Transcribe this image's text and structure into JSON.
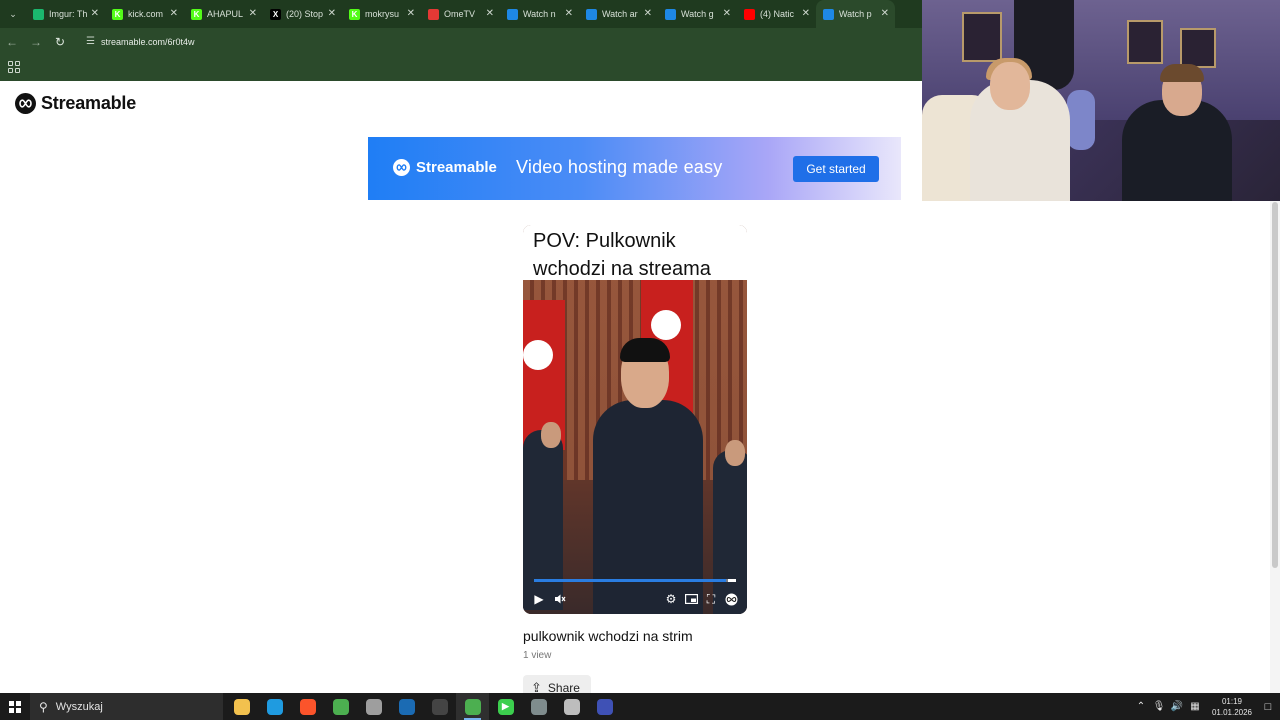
{
  "browser": {
    "tabs": [
      {
        "title": "Imgur: Th",
        "favicon_color": "#1bb76e",
        "glyph": "",
        "active": false
      },
      {
        "title": "kick.com",
        "favicon_color": "#53fc18",
        "glyph": "K",
        "active": false
      },
      {
        "title": "AHAPUL",
        "favicon_color": "#53fc18",
        "glyph": "K",
        "active": false
      },
      {
        "title": "(20) Stop",
        "favicon_color": "#000000",
        "glyph": "X",
        "active": false
      },
      {
        "title": "mokrysu",
        "favicon_color": "#53fc18",
        "glyph": "K",
        "active": false
      },
      {
        "title": "OmeTV",
        "favicon_color": "#e53935",
        "glyph": "",
        "active": false
      },
      {
        "title": "Watch n",
        "favicon_color": "#1e88e5",
        "glyph": "",
        "active": false
      },
      {
        "title": "Watch ar",
        "favicon_color": "#1e88e5",
        "glyph": "",
        "active": false
      },
      {
        "title": "Watch g",
        "favicon_color": "#1e88e5",
        "glyph": "",
        "active": false
      },
      {
        "title": "(4) Natic",
        "favicon_color": "#ff0000",
        "glyph": "",
        "active": false
      },
      {
        "title": "Watch p",
        "favicon_color": "#1e88e5",
        "glyph": "",
        "active": true
      }
    ],
    "url": "streamable.com/6r0t4w"
  },
  "page": {
    "brand": "Streamable",
    "banner": {
      "brand": "Streamable",
      "tagline": "Video hosting made easy",
      "cta": "Get started"
    },
    "video": {
      "caption": "POV: Pulkownik wchodzi na streama",
      "progress": 0.95,
      "title": "pulkownik wchodzi na strim",
      "views": "1 view",
      "share_label": "Share"
    }
  },
  "taskbar": {
    "search_placeholder": "Wyszukaj",
    "apps": [
      {
        "name": "file-explorer",
        "color": "#f2c14e",
        "glyph": "",
        "active": false
      },
      {
        "name": "edge",
        "color": "#1f9be0",
        "glyph": "",
        "active": false
      },
      {
        "name": "brave",
        "color": "#fb542b",
        "glyph": "",
        "active": false
      },
      {
        "name": "chrome",
        "color": "#4caf50",
        "glyph": "",
        "active": false
      },
      {
        "name": "app-grey",
        "color": "#9e9e9e",
        "glyph": "",
        "active": false
      },
      {
        "name": "steam",
        "color": "#1b6bb3",
        "glyph": "",
        "active": false
      },
      {
        "name": "app-circle",
        "color": "#444444",
        "glyph": "",
        "active": false
      },
      {
        "name": "app-green",
        "color": "#4caf50",
        "glyph": "",
        "active": true
      },
      {
        "name": "app-play",
        "color": "#3ccf4e",
        "glyph": "▶",
        "active": false
      },
      {
        "name": "app-character",
        "color": "#7f8c8d",
        "glyph": "",
        "active": false
      },
      {
        "name": "app-shield",
        "color": "#bdbdbd",
        "glyph": "",
        "active": false
      },
      {
        "name": "app-blue",
        "color": "#3f51b5",
        "glyph": "",
        "active": false
      }
    ],
    "time": "01:19",
    "date": "01.01.2026"
  }
}
